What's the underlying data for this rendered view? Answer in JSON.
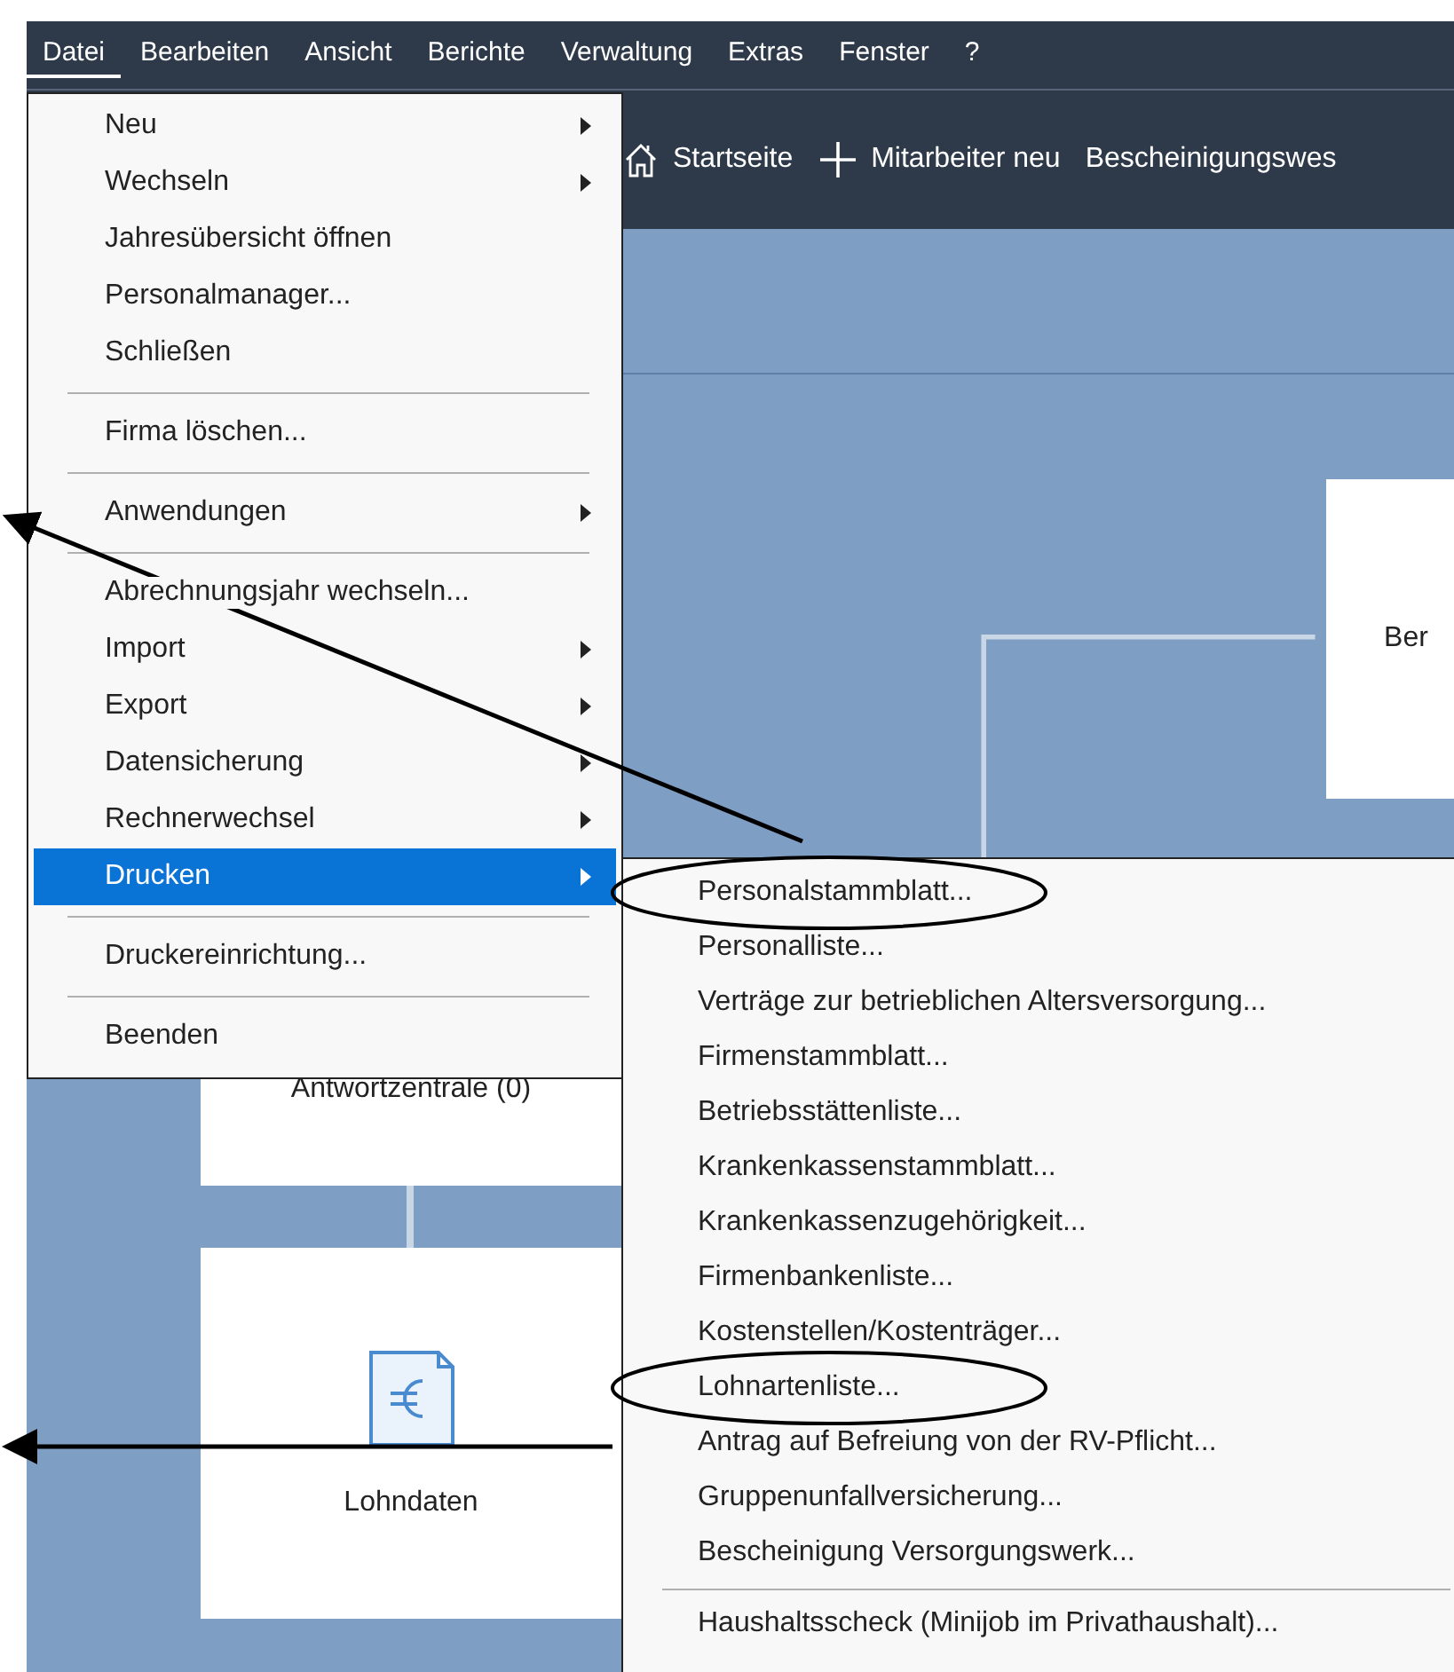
{
  "menubar": [
    {
      "label": "Datei",
      "open": true
    },
    {
      "label": "Bearbeiten",
      "open": false
    },
    {
      "label": "Ansicht",
      "open": false
    },
    {
      "label": "Berichte",
      "open": false
    },
    {
      "label": "Verwaltung",
      "open": false
    },
    {
      "label": "Extras",
      "open": false
    },
    {
      "label": "Fenster",
      "open": false
    },
    {
      "label": "?",
      "open": false
    }
  ],
  "toolbar": [
    {
      "kind": "home",
      "label": "Startseite"
    },
    {
      "kind": "plus",
      "label": "Mitarbeiter neu"
    },
    {
      "kind": "text",
      "label": "Bescheinigungswes"
    }
  ],
  "cards": [
    {
      "kind": "plain",
      "label": "Ber"
    },
    {
      "kind": "plain",
      "label": "Antwortzentrale (0)"
    },
    {
      "kind": "euro",
      "label": "Lohndaten"
    }
  ],
  "file_menu": [
    {
      "kind": "item",
      "label": "Neu",
      "submenu": true,
      "selected": false
    },
    {
      "kind": "item",
      "label": "Wechseln",
      "submenu": true,
      "selected": false
    },
    {
      "kind": "item",
      "label": "Jahresübersicht öffnen",
      "submenu": false,
      "selected": false
    },
    {
      "kind": "item",
      "label": "Personalmanager...",
      "submenu": false,
      "selected": false
    },
    {
      "kind": "item",
      "label": "Schließen",
      "submenu": false,
      "selected": false
    },
    {
      "kind": "separator"
    },
    {
      "kind": "item",
      "label": "Firma löschen...",
      "submenu": false,
      "selected": false
    },
    {
      "kind": "separator"
    },
    {
      "kind": "item",
      "label": "Anwendungen",
      "submenu": true,
      "selected": false
    },
    {
      "kind": "separator"
    },
    {
      "kind": "item",
      "label": "Abrechnungsjahr wechseln...",
      "submenu": false,
      "selected": false
    },
    {
      "kind": "item",
      "label": "Import",
      "submenu": true,
      "selected": false
    },
    {
      "kind": "item",
      "label": "Export",
      "submenu": true,
      "selected": false
    },
    {
      "kind": "item",
      "label": "Datensicherung",
      "submenu": true,
      "selected": false
    },
    {
      "kind": "item",
      "label": "Rechnerwechsel",
      "submenu": true,
      "selected": false
    },
    {
      "kind": "item",
      "label": "Drucken",
      "submenu": true,
      "selected": true
    },
    {
      "kind": "separator"
    },
    {
      "kind": "item",
      "label": "Druckereinrichtung...",
      "submenu": false,
      "selected": false
    },
    {
      "kind": "separator"
    },
    {
      "kind": "item",
      "label": "Beenden",
      "submenu": false,
      "selected": false
    }
  ],
  "print_submenu": [
    {
      "kind": "item",
      "label": "Personalstammblatt...",
      "circled": true
    },
    {
      "kind": "item",
      "label": "Personalliste...",
      "circled": false
    },
    {
      "kind": "item",
      "label": "Verträge zur betrieblichen Altersversorgung...",
      "circled": false
    },
    {
      "kind": "item",
      "label": "Firmenstammblatt...",
      "circled": false
    },
    {
      "kind": "item",
      "label": "Betriebsstättenliste...",
      "circled": false
    },
    {
      "kind": "item",
      "label": "Krankenkassenstammblatt...",
      "circled": false
    },
    {
      "kind": "item",
      "label": "Krankenkassenzugehörigkeit...",
      "circled": false
    },
    {
      "kind": "item",
      "label": "Firmenbankenliste...",
      "circled": false
    },
    {
      "kind": "item",
      "label": "Kostenstellen/Kostenträger...",
      "circled": false
    },
    {
      "kind": "item",
      "label": "Lohnartenliste...",
      "circled": true
    },
    {
      "kind": "item",
      "label": "Antrag auf Befreiung von der RV-Pflicht...",
      "circled": false
    },
    {
      "kind": "item",
      "label": "Gruppenunfallversicherung...",
      "circled": false
    },
    {
      "kind": "item",
      "label": "Bescheinigung Versorgungswerk...",
      "circled": false
    },
    {
      "kind": "separator"
    },
    {
      "kind": "item",
      "label": "Haushaltsscheck (Minijob im Privathaushalt)...",
      "circled": false
    }
  ]
}
